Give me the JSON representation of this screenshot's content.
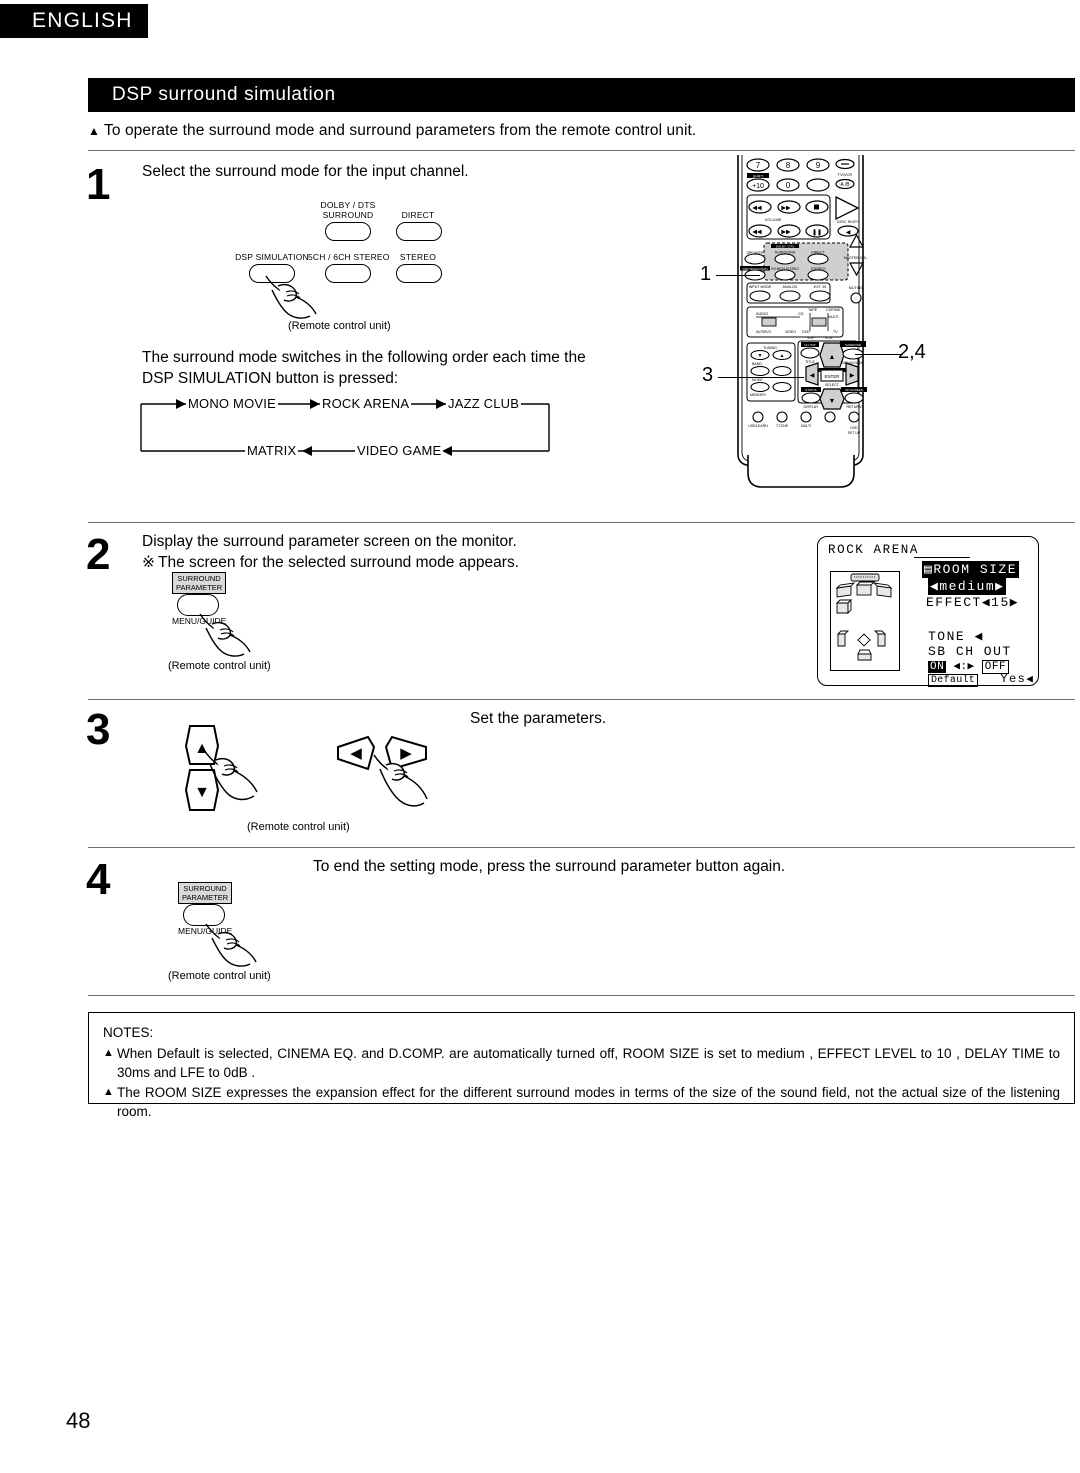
{
  "language_tab": "ENGLISH",
  "section_title": "DSP surround simulation",
  "intro": "To operate the surround mode and surround parameters from the remote control unit.",
  "page_number": "48",
  "remote_caption": "(Remote control unit)",
  "steps": [
    {
      "number": "1",
      "text": "Select the surround mode for the input channel.",
      "paragraph": "The surround mode switches in the following order each time the DSP SIMULATION button is pressed:"
    },
    {
      "number": "2",
      "text": "Display the surround parameter screen on the monitor.",
      "note_mark": "※",
      "note": "The screen for the selected surround mode appears."
    },
    {
      "number": "3",
      "text": "Set the parameters."
    },
    {
      "number": "4",
      "text": "To end the setting mode, press the surround parameter button again."
    }
  ],
  "button_cluster": {
    "dolby_dts_line1": "DOLBY / DTS",
    "dolby_dts_line2": "SURROUND",
    "direct": "DIRECT",
    "dsp_simulation": "DSP SIMULATION",
    "ch_stereo": "5CH / 6CH STEREO",
    "stereo": "STEREO"
  },
  "mode_sequence": {
    "top": [
      "MONO MOVIE",
      "ROCK ARENA",
      "JAZZ CLUB"
    ],
    "bottom": [
      "MATRIX",
      "VIDEO GAME"
    ]
  },
  "remote_callouts": {
    "one": "1",
    "two_four": "2,4",
    "three": "3"
  },
  "remote_labels": {
    "num7": "7",
    "num8": "8",
    "num9": "9",
    "plus10": "+10",
    "num0": "0",
    "tv_vcr": "TV/VCR",
    "ab": "A /B",
    "shift": "SHIFT",
    "volume": "VOLUME",
    "disc_skip": "DISC SKIP+",
    "speaker": "SPEAKER",
    "dolby_dts": "DOLBY / DTS",
    "surround": "SURROUND",
    "direct": "DIRECT",
    "dsp_simulation": "DSP SIMULATION",
    "ch_stereo": "5CH/6CH STEREO",
    "stereo": "STEREO",
    "input_mode": "INPUT MODE",
    "analog": "ANALOG",
    "ext_in": "EXT. IN",
    "audio": "AUDIO",
    "cd": "CD",
    "tape": "TAPE",
    "cdr_md": "CDR/MD",
    "multi": "MULTI",
    "av_srvc": "AV/SRVC",
    "video": "VIDEO",
    "dvd": "DVD",
    "vdp": "VDP",
    "vcr": "VCR",
    "tv": "TV",
    "master_vol": "MASTER VOL.",
    "muting": "MUTING",
    "tuning": "TUNING",
    "band": "BAND",
    "mode": "MODE",
    "memory": "MEMORY",
    "ch_top": "CH TOP",
    "title": "TITLE",
    "cursor_mode": "CURSOR MODE",
    "enter": "ENTER",
    "select": "SELECT",
    "status": "STATUS",
    "display": "DISPLAY",
    "on_screen": "ON SCREEN",
    "return": "RETURN",
    "surround_parameter": "SURROUND PARAMETER",
    "menu_guide": "MENU/GUIDE",
    "use_learn": "USE/LEARN",
    "t_tone": "T.TONE",
    "multi_btn": "MULTI",
    "dvd_setup_1": "DVD",
    "dvd_setup_2": "SET UP"
  },
  "sp_button": {
    "cap_line1": "SURROUND",
    "cap_line2": "PARAMETER",
    "sub": "MENU/GUIDE"
  },
  "osd": {
    "mode_title": "ROCK  ARENA",
    "room_size_label": "ROOM  SIZE",
    "room_size_value": "medium",
    "effect_label": "EFFECT",
    "effect_value": "15",
    "tone_label": "TONE",
    "sb_ch_out_label": "SB  CH  OUT",
    "on": "ON",
    "off": "OFF",
    "separator": ":",
    "default": "Default",
    "yes": "Yes",
    "left_arrow": "◀",
    "right_arrow": "▶"
  },
  "notes": {
    "heading": "NOTES:",
    "items": [
      "When  Default  is selected,  CINEMA EQ.  and  D.COMP.  are automatically turned off,  ROOM SIZE  is set to  medium ,  EFFECT LEVEL  to  10 ,  DELAY TIME  to  30ms  and  LFE  to  0dB .",
      "The  ROOM SIZE  expresses the expansion effect for the different surround modes in terms of the size of the sound field, not the actual size of the listening room."
    ]
  },
  "colors": {
    "bar_background": "#000000",
    "bar_text": "#ffffff",
    "rule": "#6f6f6f",
    "highlight_gray": "#d9d9d9"
  }
}
